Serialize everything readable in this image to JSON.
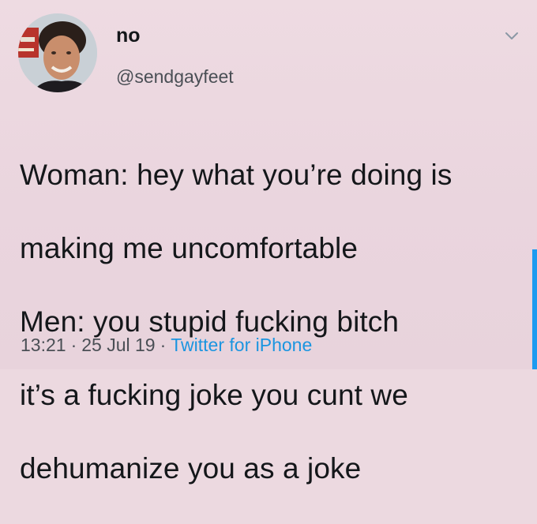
{
  "tweet": {
    "display_name": "no",
    "handle": "@sendgayfeet",
    "text_lines": [
      "Woman: hey what you’re doing is",
      "making me uncomfortable",
      "Men: you stupid fucking bitch",
      "it’s a fucking joke you cunt we",
      "dehumanize you as a joke"
    ],
    "time": "13:21",
    "date": "25 Jul 19",
    "separator": "·",
    "source": "Twitter for iPhone"
  },
  "icons": {
    "menu": "chevron-down-icon",
    "avatar": "avatar"
  },
  "colors": {
    "background": "#ecd9e0",
    "text": "#14171a",
    "secondary_text": "#4a4f55",
    "link": "#1b95e0",
    "accent_bar": "#1d9bf0"
  }
}
